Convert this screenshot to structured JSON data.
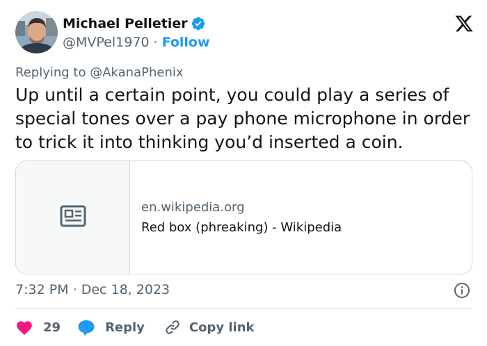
{
  "author": {
    "name": "Michael Pelletier",
    "handle": "@MVPel1970",
    "separator": "·",
    "follow_label": "Follow"
  },
  "icons": {
    "verified": "verified-badge-icon",
    "logo": "x-logo-icon",
    "card": "article-icon",
    "info": "info-icon",
    "like": "heart-icon",
    "reply": "speech-bubble-icon",
    "copy": "link-icon"
  },
  "colors": {
    "accent": "#1d9bf0",
    "like": "#f91880",
    "secondary_text": "#536471"
  },
  "reply_context": {
    "prefix": "Replying to",
    "mention": "@AkanaPhenix"
  },
  "tweet": {
    "text": "Up until a certain point, you could play a series of special tones over a pay phone microphone in order to trick it into thinking you’d inserted a coin."
  },
  "link_card": {
    "domain": "en.wikipedia.org",
    "title": "Red box (phreaking) - Wikipedia"
  },
  "meta": {
    "time": "7:32 PM",
    "separator": "·",
    "date": "Dec 18, 2023"
  },
  "actions": {
    "like_count": "29",
    "reply_label": "Reply",
    "copy_link_label": "Copy link"
  }
}
